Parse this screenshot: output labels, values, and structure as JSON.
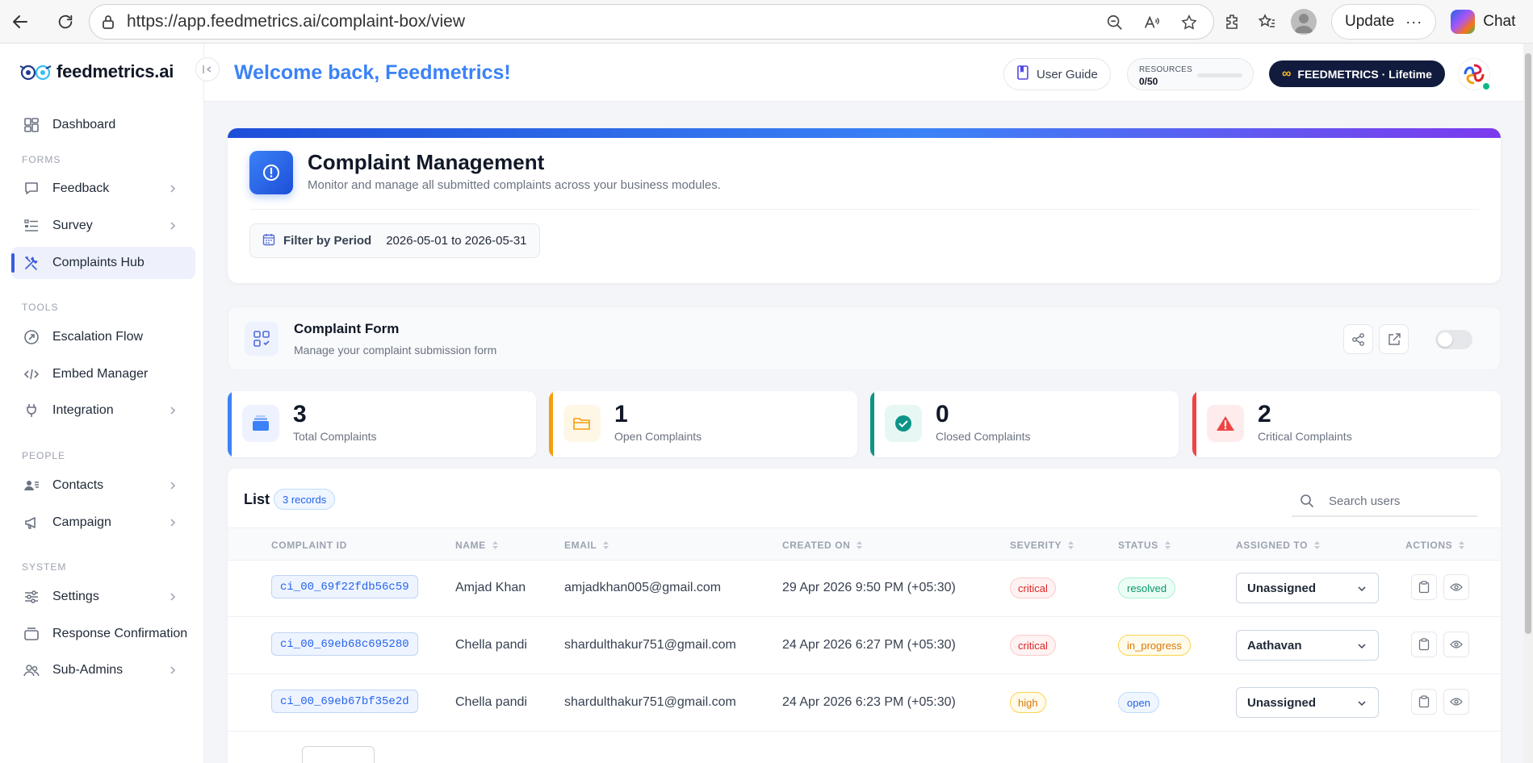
{
  "browser": {
    "url": "https://app.feedmetrics.ai/complaint-box/view",
    "update_label": "Update",
    "chat_label": "Chat"
  },
  "sidebar": {
    "brand": "feedmetrics.ai",
    "items": [
      {
        "label": "Dashboard",
        "icon": "dashboard-icon"
      },
      {
        "label": "Feedback",
        "icon": "chat-icon"
      },
      {
        "label": "Survey",
        "icon": "survey-icon"
      },
      {
        "label": "Complaints Hub",
        "icon": "tools-icon",
        "active": true
      },
      {
        "label": "Escalation Flow",
        "icon": "escalation-icon"
      },
      {
        "label": "Embed Manager",
        "icon": "code-icon"
      },
      {
        "label": "Integration",
        "icon": "plug-icon"
      },
      {
        "label": "Contacts",
        "icon": "contacts-icon"
      },
      {
        "label": "Campaign",
        "icon": "megaphone-icon"
      },
      {
        "label": "Settings",
        "icon": "settings-icon"
      },
      {
        "label": "Response Confirmation",
        "icon": "inbox-icon"
      },
      {
        "label": "Sub-Admins",
        "icon": "users-icon"
      }
    ],
    "sections": {
      "forms": "FORMS",
      "tools": "TOOLS",
      "people": "PEOPLE",
      "system": "SYSTEM"
    }
  },
  "header": {
    "welcome": "Welcome back, Feedmetrics!",
    "user_guide": "User Guide",
    "resources_label": "RESOURCES",
    "resources_value": "0/50",
    "resources_fraction": 0,
    "plan": "FEEDMETRICS · Lifetime"
  },
  "hero": {
    "title": "Complaint Management",
    "subtitle": "Monitor and manage all submitted complaints across your business modules.",
    "filter_label": "Filter by Period",
    "filter_value": "2026-05-01 to 2026-05-31"
  },
  "complaint_form": {
    "title": "Complaint Form",
    "subtitle": "Manage your complaint submission form",
    "enabled": false
  },
  "stats": [
    {
      "value": "3",
      "label": "Total Complaints",
      "color": "#3b82f6"
    },
    {
      "value": "1",
      "label": "Open Complaints",
      "color": "#f59e0b"
    },
    {
      "value": "0",
      "label": "Closed Complaints",
      "color": "#0d9488"
    },
    {
      "value": "2",
      "label": "Critical Complaints",
      "color": "#ef4444"
    }
  ],
  "list": {
    "title": "List",
    "records": "3 records",
    "search_placeholder": "Search users",
    "columns": [
      "COMPLAINT ID",
      "NAME",
      "EMAIL",
      "CREATED ON",
      "SEVERITY",
      "STATUS",
      "ASSIGNED TO",
      "ACTIONS"
    ],
    "rows": [
      {
        "id": "ci_00_69f22fdb56c59",
        "name": "Amjad Khan",
        "email": "amjadkhan005@gmail.com",
        "created": "29 Apr 2026 9:50 PM (+05:30)",
        "severity": "critical",
        "status": "resolved",
        "assigned": "Unassigned"
      },
      {
        "id": "ci_00_69eb68c695280",
        "name": "Chella pandi",
        "email": "shardulthakur751@gmail.com",
        "created": "24 Apr 2026 6:27 PM (+05:30)",
        "severity": "critical",
        "status": "in_progress",
        "assigned": "Aathavan"
      },
      {
        "id": "ci_00_69eb67bf35e2d",
        "name": "Chella pandi",
        "email": "shardulthakur751@gmail.com",
        "created": "24 Apr 2026 6:23 PM (+05:30)",
        "severity": "high",
        "status": "open",
        "assigned": "Unassigned"
      }
    ]
  },
  "colors": {
    "accent": "#3b82f6",
    "critical": "#dc2626",
    "high": "#d97706",
    "resolved": "#059669",
    "in_progress": "#d97706",
    "open": "#2563eb"
  }
}
